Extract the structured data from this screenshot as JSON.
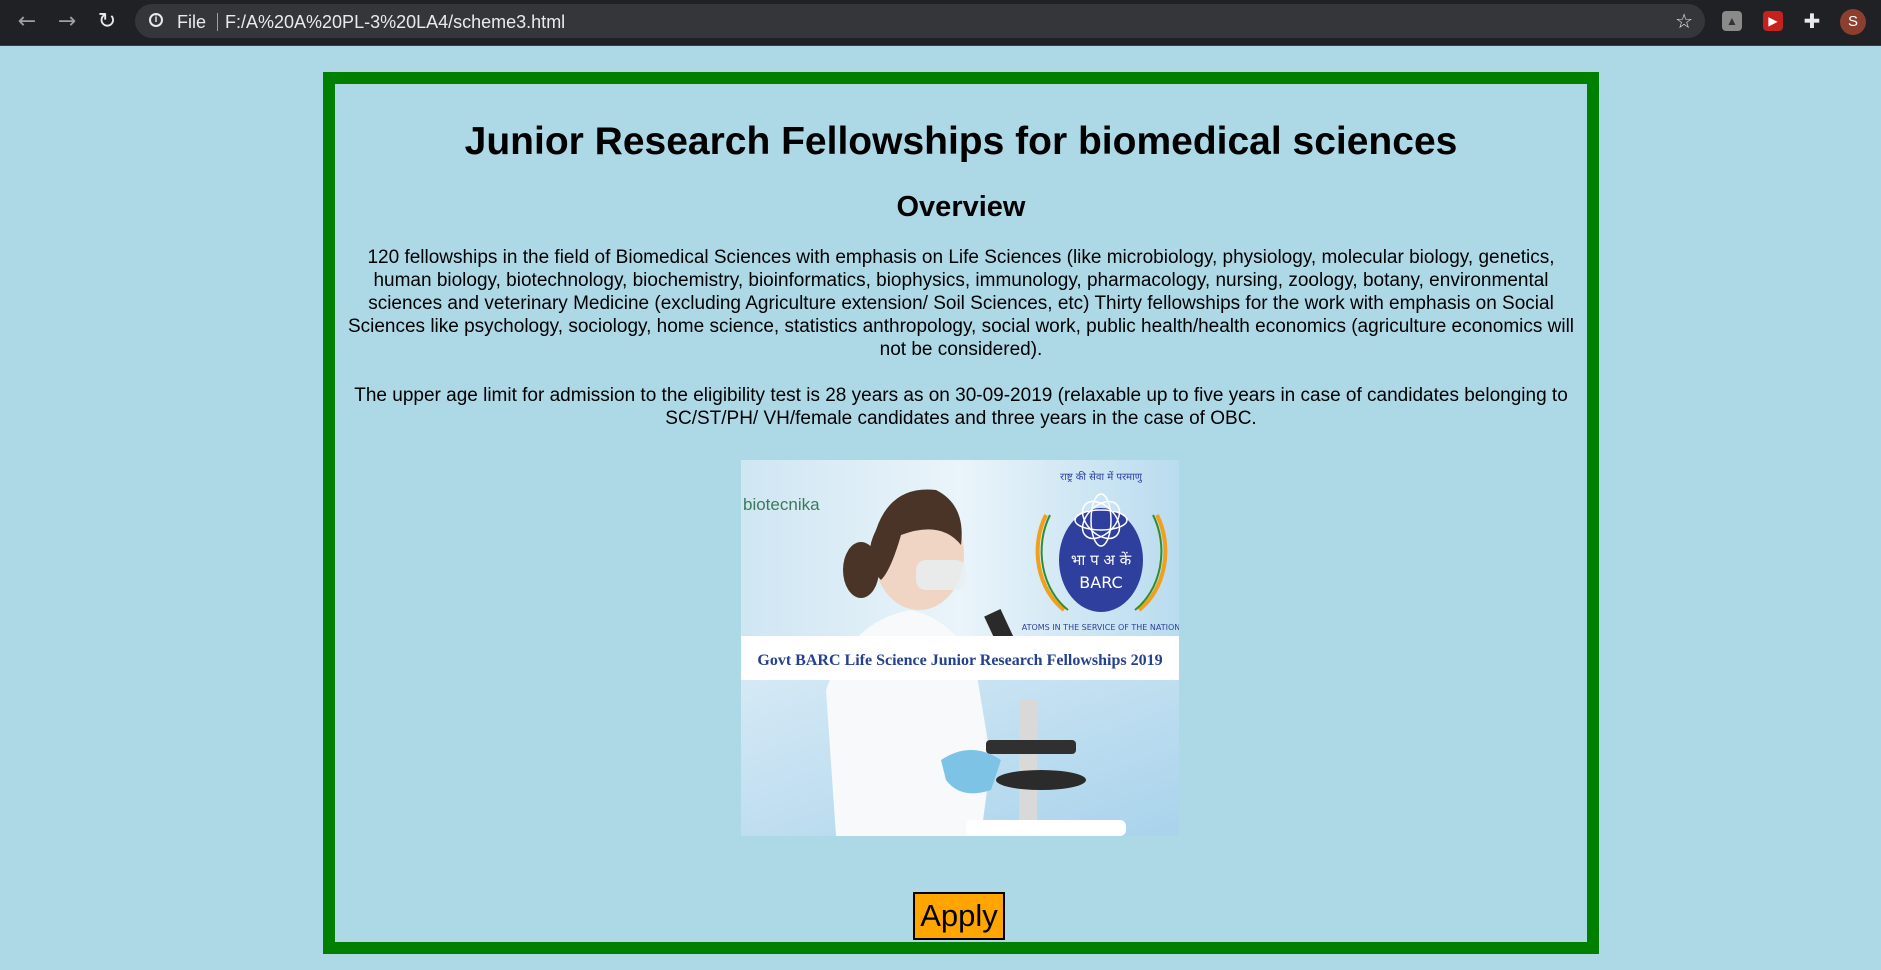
{
  "browser": {
    "scheme_label": "File",
    "url": "F:/A%20A%20PL-3%20LA4/scheme3.html",
    "profile_initial": "S"
  },
  "page": {
    "title": "Junior Research Fellowships for biomedical sciences",
    "subtitle": "Overview",
    "paragraph1": "120 fellowships in the field of Biomedical Sciences with emphasis on Life Sciences (like microbiology, physiology, molecular biology, genetics, human biology, biotechnology, biochemistry, bioinformatics, biophysics, immunology, pharmacology, nursing, zoology, botany, environmental sciences and veterinary Medicine (excluding Agriculture extension/ Soil Sciences, etc) Thirty fellowships for the work with emphasis on Social Sciences like psychology, sociology, home science, statistics anthropology, social work, public health/health economics (agriculture economics will not be considered).",
    "paragraph2": "The upper age limit for admission to the eligibility test is 28 years as on 30-09-2019 (relaxable up to five years in case of candidates belonging to SC/ST/PH/ VH/female candidates and three years in the case of OBC.",
    "apply_label": "Apply"
  },
  "banner": {
    "watermark": "biotecnika",
    "caption": "Govt BARC Life Science Junior Research Fellowships 2019",
    "logo_hindi_top": "राष्ट्र की सेवा में परमाणु",
    "logo_hindi_center": "भा प अ कें",
    "logo_name": "BARC",
    "logo_motto": "ATOMS IN THE SERVICE OF THE NATION"
  },
  "colors": {
    "page_background": "#add8e6",
    "card_border": "#008000",
    "apply_button": "#ffa500"
  },
  "icons": [
    "back-arrow-icon",
    "forward-arrow-icon",
    "reload-icon",
    "info-icon",
    "star-icon",
    "pdf-extension-icon",
    "red-extension-icon",
    "puzzle-extension-icon"
  ]
}
